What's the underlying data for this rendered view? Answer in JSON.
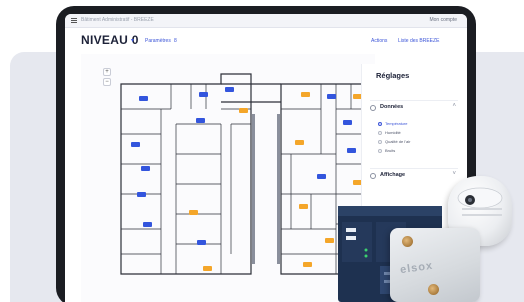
{
  "app": {
    "breadcrumb": "Bâtiment Administratif - BREEZE",
    "account_label": "Mon compte"
  },
  "header": {
    "page_title": "NIVEAU 0",
    "params_label": "Paramètres",
    "params_count": "8",
    "actions_label": "Actions",
    "sensor_list_label": "Liste des BREEZE"
  },
  "panel": {
    "title": "Réglages",
    "sections": [
      {
        "label": "Données",
        "expanded": true
      },
      {
        "label": "Affichage",
        "expanded": false
      }
    ],
    "data_options": [
      {
        "label": "Température",
        "selected": true
      },
      {
        "label": "Humidité",
        "selected": false
      },
      {
        "label": "Qualité de l'air",
        "selected": false
      },
      {
        "label": "Bruits",
        "selected": false
      }
    ]
  },
  "map": {
    "zoom_in_label": "+",
    "zoom_out_label": "−"
  },
  "device": {
    "brand": "elsox"
  },
  "colors": {
    "accent": "#3c55d8",
    "sensor_blue": "#3355dd",
    "sensor_orange": "#f4a62a"
  }
}
